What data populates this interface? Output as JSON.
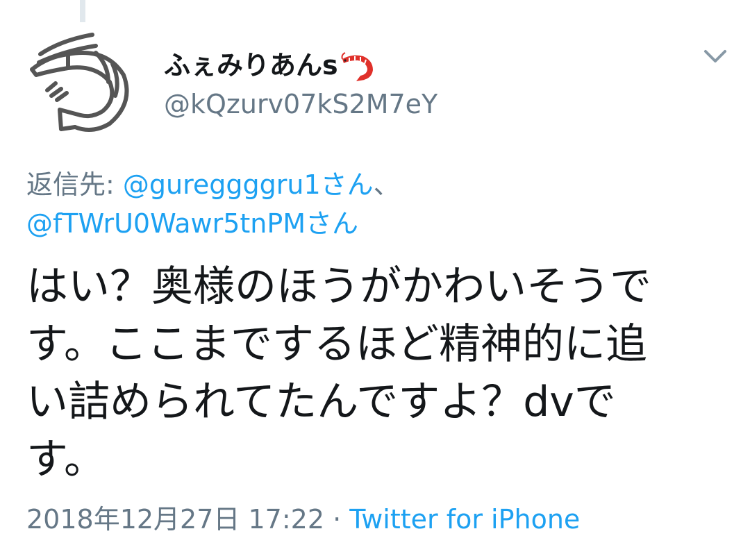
{
  "tweet": {
    "display_name": "ふぇみりあんs",
    "name_emoji": "shrimp-emoji",
    "handle": "@kQzurv07kS2M7eY",
    "reply_prefix": "返信先: ",
    "reply_users": [
      "@gureggggru1さん",
      "@fTWrU0Wawr5tnPMさん"
    ],
    "reply_separator": "、",
    "text_lines": [
      "はい？奥様のほうがかわいそうで",
      "す。ここまでするほど精神的に追",
      "い詰められてたんですよ？dvで",
      "す。"
    ],
    "timestamp": "2018年12月27日 17:22",
    "meta_separator": " · ",
    "source": "Twitter for iPhone"
  },
  "icons": {
    "avatar": "shrimp-line-drawing-avatar",
    "menu": "chevron-down-icon"
  },
  "colors": {
    "link": "#1da1f2",
    "secondary_text": "#657786",
    "primary_text": "#14171a",
    "emoji_red": "#e0302a"
  }
}
